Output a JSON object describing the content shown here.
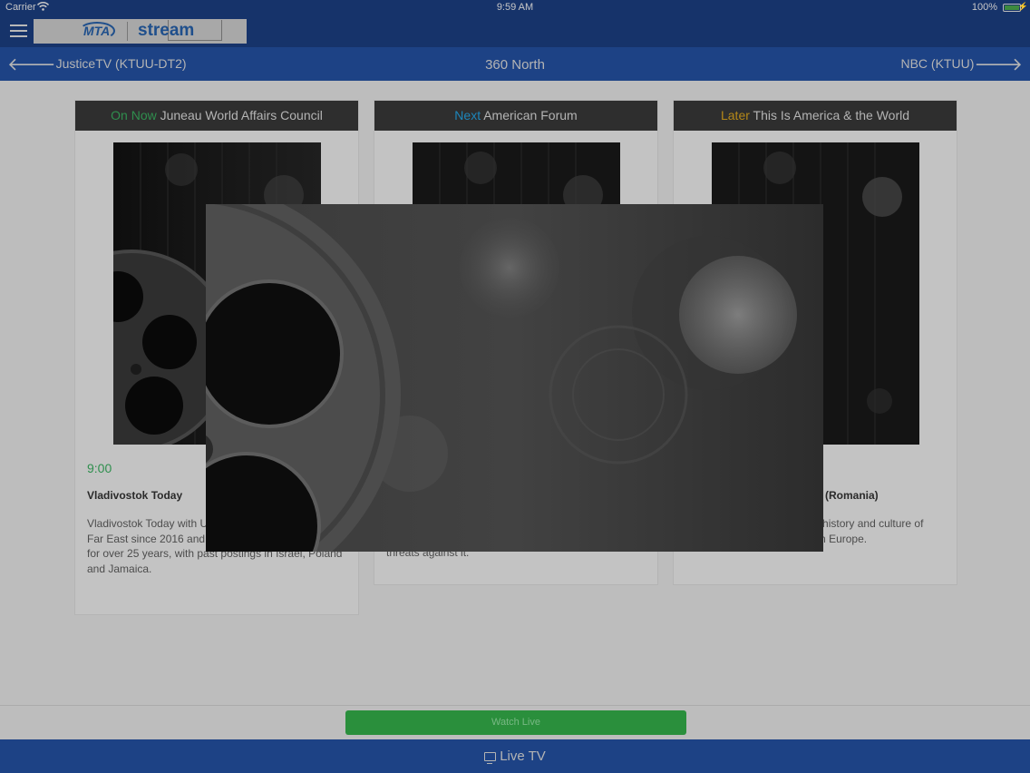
{
  "status_bar": {
    "carrier": "Carrier",
    "time": "9:59 AM",
    "battery": "100%"
  },
  "header": {
    "logo_left": "MTA",
    "logo_right": "stream"
  },
  "channel_nav": {
    "prev": "JusticeTV (KTUU-DT2)",
    "current": "360 North",
    "next": "NBC (KTUU)"
  },
  "cards": [
    {
      "tag": "On Now",
      "title": " Juneau World Affairs Council",
      "time": "9:00",
      "program_title": "Vladivostok Today",
      "description": "Vladivostok Today with U... Keays who has led the U... Far East since 2016 and been in the Foreign Service for over 25 years, with past postings in Israel, Poland and Jamaica."
    },
    {
      "tag": "Next",
      "title": " American Forum",
      "time": "",
      "program_title": "",
      "description": "threats against it."
    },
    {
      "tag": "Later",
      "title": " This Is America & the World",
      "time": "",
      "program_title": "(Romania)",
      "description": "...nia's Ambassador to the ...history and culture of Romania within southeastern Europe."
    }
  ],
  "watch_live_label": "Watch Live",
  "tab_bar": {
    "live_tv": "Live TV"
  },
  "colors": {
    "header": "#16336a",
    "nav": "#1d4285",
    "on_now": "#2f8f4e",
    "next": "#1d86bb",
    "later": "#b58818",
    "watch_live": "#2a8f3c"
  }
}
